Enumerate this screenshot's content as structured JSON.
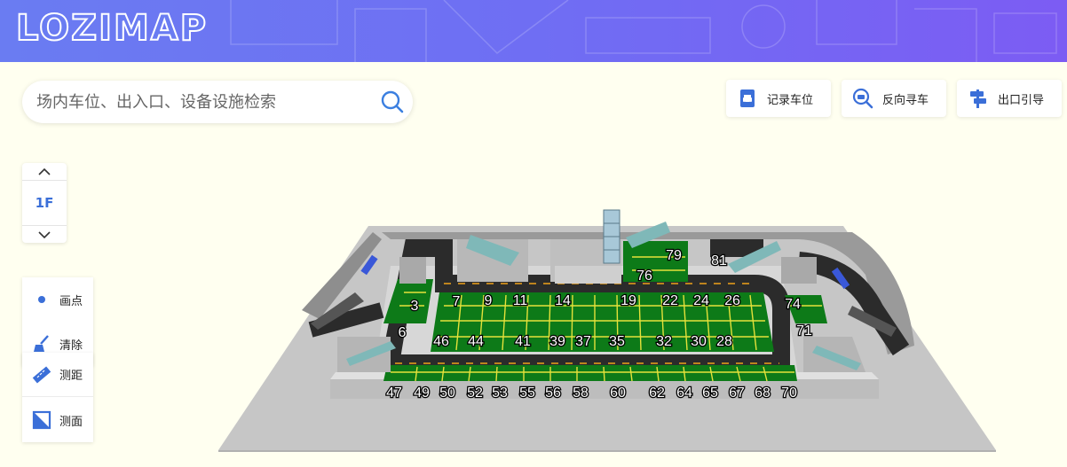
{
  "header": {
    "logo_text": "LOZIMAP"
  },
  "search": {
    "placeholder": "场内车位、出入口、设备设施检索"
  },
  "toolbar": {
    "record_label": "记录车位",
    "find_car_label": "反向寻车",
    "exit_label": "出口引导"
  },
  "floor_selector": {
    "current": "1F"
  },
  "tools": {
    "point_label": "画点",
    "clear_label": "清除",
    "distance_label": "测距",
    "area_label": "测面"
  },
  "colors": {
    "header_gradient_start": "#6a7cf2",
    "header_gradient_end": "#7c5cf3",
    "accent": "#3b6fd8",
    "parking_green": "#0d7a18",
    "road": "#2b2b2b",
    "wall": "#c8c8c8",
    "background": "#fffff0"
  },
  "map_labels": [
    "3",
    "6",
    "7",
    "9",
    "11",
    "14",
    "19",
    "22",
    "24",
    "26",
    "28",
    "30",
    "32",
    "35",
    "37",
    "39",
    "41",
    "44",
    "46",
    "47",
    "49",
    "50",
    "52",
    "53",
    "55",
    "56",
    "58",
    "60",
    "62",
    "64",
    "65",
    "67",
    "68",
    "70",
    "71",
    "74",
    "76",
    "79",
    "81"
  ]
}
